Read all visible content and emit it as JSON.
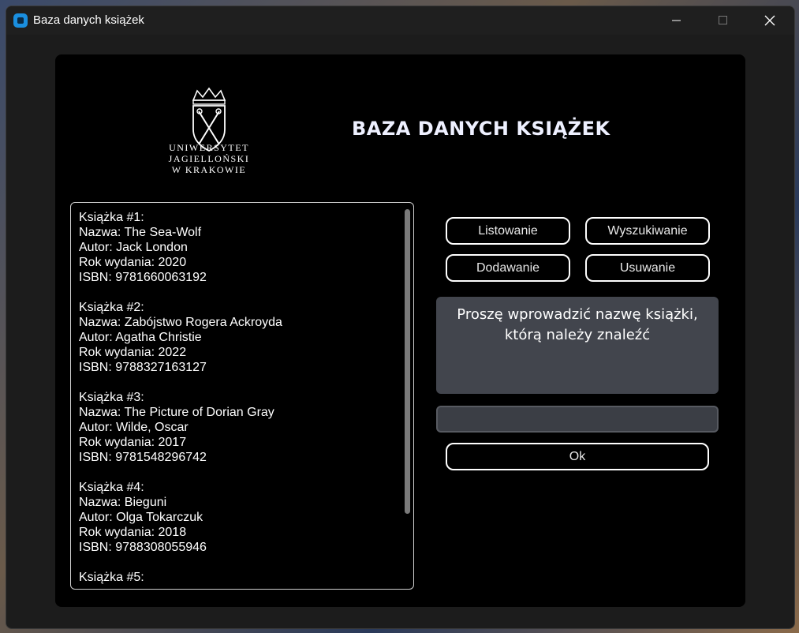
{
  "window": {
    "title": "Baza danych książek"
  },
  "logo": {
    "lines": [
      "UNIWERSYTET",
      "JAGIELLOŃSKI",
      "W KRAKOWIE"
    ]
  },
  "header": {
    "title": "BAZA DANYCH KSIĄŻEK"
  },
  "books": [
    {
      "heading": "Książka #1:",
      "name": "Nazwa: The Sea-Wolf",
      "author": "Autor: Jack London",
      "year": "Rok wydania: 2020",
      "isbn": "ISBN: 9781660063192"
    },
    {
      "heading": "Książka #2:",
      "name": "Nazwa: Zabójstwo Rogera Ackroyda",
      "author": "Autor: Agatha Christie",
      "year": "Rok wydania: 2022",
      "isbn": "ISBN: 9788327163127"
    },
    {
      "heading": "Książka #3:",
      "name": "Nazwa: The Picture of Dorian Gray",
      "author": "Autor: Wilde, Oscar",
      "year": "Rok wydania: 2017",
      "isbn": "ISBN: 9781548296742"
    },
    {
      "heading": "Książka #4:",
      "name": "Nazwa: Bieguni",
      "author": "Autor: Olga Tokarczuk",
      "year": "Rok wydania: 2018",
      "isbn": "ISBN: 9788308055946"
    },
    {
      "heading": "Książka #5:"
    }
  ],
  "buttons": {
    "listing": "Listowanie",
    "search": "Wyszukiwanie",
    "add": "Dodawanie",
    "remove": "Usuwanie",
    "ok": "Ok"
  },
  "prompt": {
    "line1": "Proszę wprowadzić nazwę książki,",
    "line2": "którą należy znaleźć"
  },
  "input": {
    "value": ""
  },
  "colors": {
    "accent_icon": "#1a8fe0",
    "prompt_bg": "#42454d",
    "panel_bg": "#000000"
  }
}
